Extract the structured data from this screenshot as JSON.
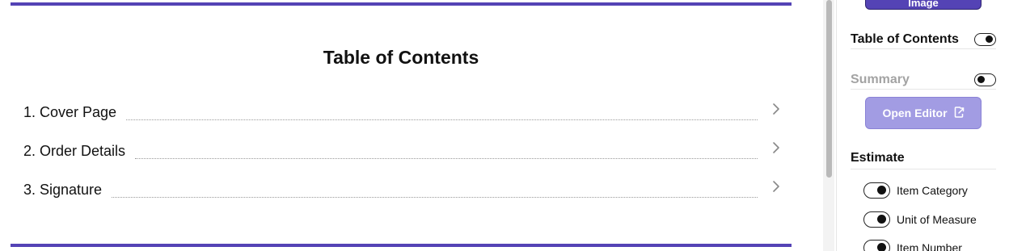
{
  "document": {
    "toc_title": "Table of Contents",
    "toc_items": [
      {
        "label": "1. Cover Page"
      },
      {
        "label": "2. Order Details"
      },
      {
        "label": "3. Signature"
      }
    ]
  },
  "panel": {
    "image_button_label": "Image",
    "table_of_contents": {
      "label": "Table of Contents",
      "enabled": true
    },
    "summary": {
      "label": "Summary",
      "enabled": false
    },
    "open_editor_label": "Open Editor",
    "estimate_title": "Estimate",
    "estimate_options": [
      {
        "label": "Item Category",
        "enabled": true
      },
      {
        "label": "Unit of Measure",
        "enabled": true
      },
      {
        "label": "Item Number",
        "enabled": true
      }
    ]
  },
  "colors": {
    "accent": "#5443b5",
    "accent_light": "#a29ce3"
  }
}
